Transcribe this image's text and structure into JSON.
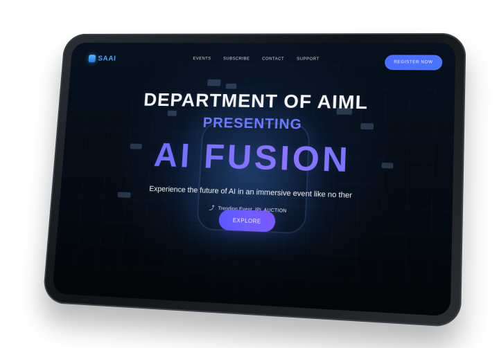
{
  "nav": {
    "logo_text": "SAAI",
    "links": [
      "EVENTS",
      "SUBSCRIBE",
      "CONTACT",
      "SUPPORT"
    ],
    "register_label": "REGISTER NOW"
  },
  "hero": {
    "department": "DEPARTMENT OF AIML",
    "presenting": "PRESENTING",
    "title": "AI FUSION",
    "tagline": "Experience the future of AI in an immersive event like no ther",
    "trending_label": "Trending Event, IPL AUCTION",
    "explore_label": "EXPLORE"
  },
  "icons": {
    "logo_icon": "logo-icon",
    "trend_icon": "trend-icon"
  },
  "colors": {
    "accent": "#5a63ff",
    "logo": "#4aa7ff",
    "background": "#050b14"
  }
}
